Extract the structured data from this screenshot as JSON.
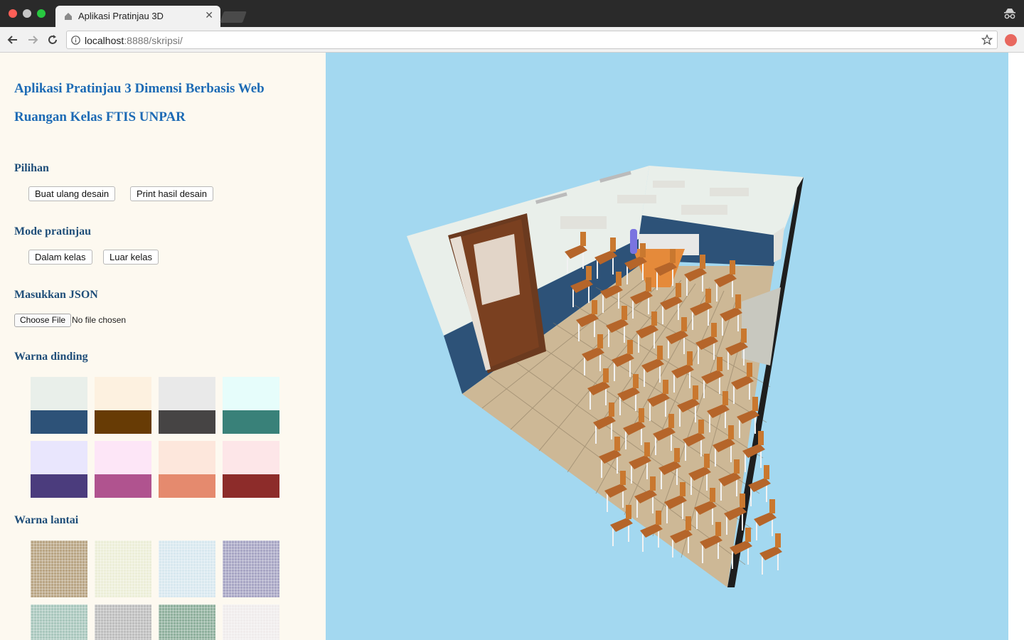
{
  "browser": {
    "tab_title": "Aplikasi Pratinjau 3D",
    "url_host": "localhost",
    "url_rest": ":8888/skripsi/"
  },
  "sidebar": {
    "title_line1": "Aplikasi Pratinjau 3 Dimensi Berbasis Web",
    "title_line2": "Ruangan Kelas FTIS UNPAR",
    "pilihan": {
      "title": "Pilihan",
      "buttons": [
        "Buat ulang desain",
        "Print hasil desain"
      ]
    },
    "mode": {
      "title": "Mode pratinjau",
      "buttons": [
        "Dalam kelas",
        "Luar kelas"
      ]
    },
    "json": {
      "title": "Masukkan JSON",
      "file_button": "Choose File",
      "file_status": "No file chosen"
    },
    "wall_colors": {
      "title": "Warna dinding",
      "swatches": [
        {
          "top": "#e9efea",
          "bottom": "#2d5278"
        },
        {
          "top": "#fdf1e0",
          "bottom": "#673b05"
        },
        {
          "top": "#e9e9e9",
          "bottom": "#464444"
        },
        {
          "top": "#e6fdfb",
          "bottom": "#398179"
        },
        {
          "top": "#e9e6fd",
          "bottom": "#4b3c7d"
        },
        {
          "top": "#fde6f7",
          "bottom": "#b0538f"
        },
        {
          "top": "#fde7dc",
          "bottom": "#e58a6e"
        },
        {
          "top": "#fde6e8",
          "bottom": "#8d2c2a"
        }
      ]
    },
    "floor_colors": {
      "title": "Warna lantai",
      "swatches": [
        "#b9a584",
        "#eceed8",
        "#d8e8ef",
        "#a8a6c4",
        "#a9c7bd",
        "#bebebe",
        "#8fb09d",
        "#f0ecec"
      ]
    }
  },
  "viewport": {
    "sky_color": "#a3d8f0",
    "wall_color": "#e9efea",
    "wall_trim_color": "#2d5278",
    "floor_color": "#cdb896"
  }
}
